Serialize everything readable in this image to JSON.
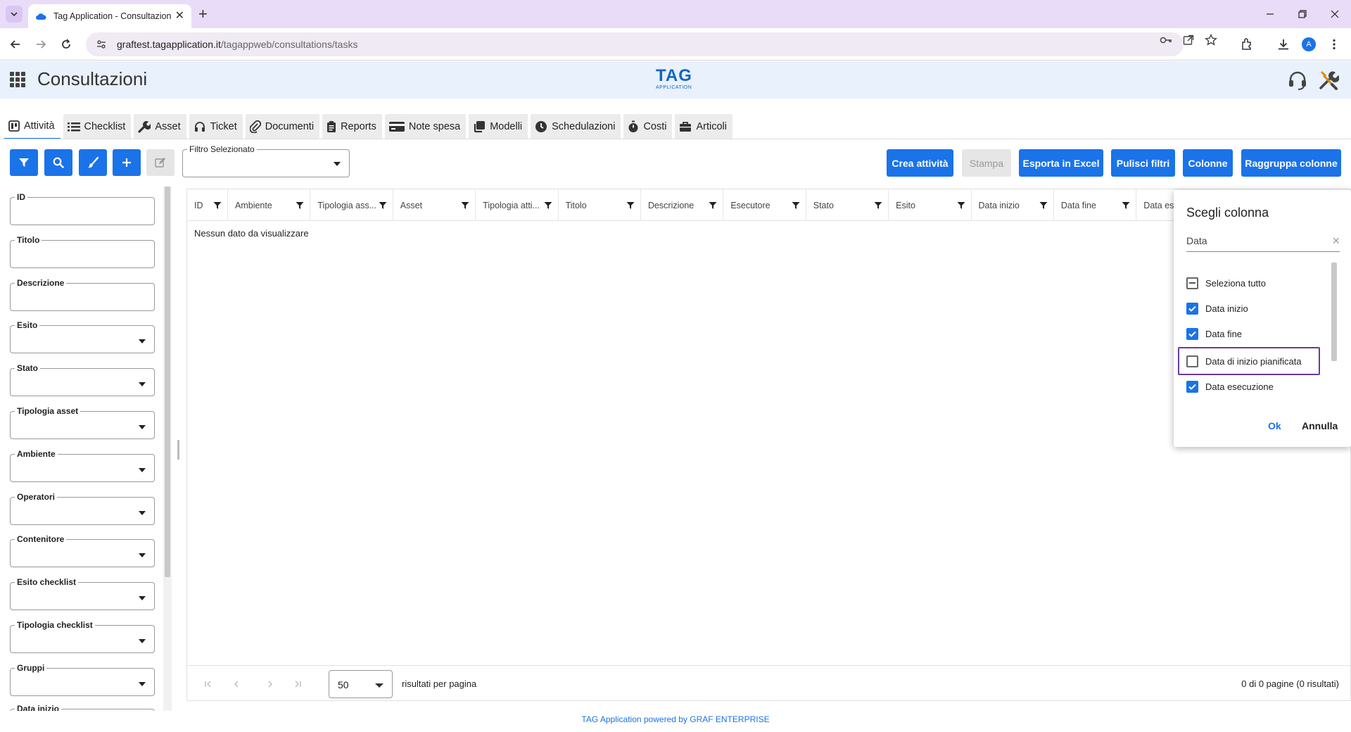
{
  "browser": {
    "tab_title": "Tag Application - Consultazioni",
    "url_host": "graftest.tagapplication.it",
    "url_path": "/tagappweb/consultations/tasks",
    "avatar_letter": "A"
  },
  "app": {
    "title": "Consultazioni",
    "logo_text": "TAG",
    "logo_sub": "APPLICATION",
    "accent": "#1a73e8"
  },
  "tabs": [
    {
      "label": "Attività",
      "icon": "board-icon"
    },
    {
      "label": "Checklist",
      "icon": "list-icon"
    },
    {
      "label": "Asset",
      "icon": "wrench-icon"
    },
    {
      "label": "Ticket",
      "icon": "headset-icon"
    },
    {
      "label": "Documenti",
      "icon": "paperclip-icon"
    },
    {
      "label": "Reports",
      "icon": "clipboard-icon"
    },
    {
      "label": "Note spesa",
      "icon": "credit-card-icon"
    },
    {
      "label": "Modelli",
      "icon": "copy-icon"
    },
    {
      "label": "Schedulazioni",
      "icon": "clock-icon"
    },
    {
      "label": "Costi",
      "icon": "stopwatch-icon"
    },
    {
      "label": "Articoli",
      "icon": "toolbox-icon"
    }
  ],
  "toolbar": {
    "filter_select_label": "Filtro Selezionato",
    "buttons": [
      "Crea attività",
      "Stampa",
      "Esporta in Excel",
      "Pulisci filtri",
      "Colonne",
      "Raggruppa colonne"
    ]
  },
  "filters": [
    {
      "label": "ID",
      "dropdown": false
    },
    {
      "label": "Titolo",
      "dropdown": false
    },
    {
      "label": "Descrizione",
      "dropdown": false
    },
    {
      "label": "Esito",
      "dropdown": true
    },
    {
      "label": "Stato",
      "dropdown": true
    },
    {
      "label": "Tipologia asset",
      "dropdown": true
    },
    {
      "label": "Ambiente",
      "dropdown": true
    },
    {
      "label": "Operatori",
      "dropdown": true
    },
    {
      "label": "Contenitore",
      "dropdown": true
    },
    {
      "label": "Esito checklist",
      "dropdown": true
    },
    {
      "label": "Tipologia checklist",
      "dropdown": true
    },
    {
      "label": "Gruppi",
      "dropdown": true
    },
    {
      "label": "Data inizio",
      "dropdown": false
    }
  ],
  "grid": {
    "columns": [
      "ID",
      "Ambiente",
      "Tipologia ass...",
      "Asset",
      "Tipologia atti...",
      "Titolo",
      "Descrizione",
      "Esecutore",
      "Stato",
      "Esito",
      "Data inizio",
      "Data fine",
      "Data ese"
    ],
    "empty_text": "Nessun dato da visualizzare",
    "page_size": "50",
    "page_size_label": "risultati per pagina",
    "page_info": "0 di 0 pagine (0 risultati)"
  },
  "column_chooser": {
    "title": "Scegli colonna",
    "search_value": "Data",
    "options": [
      {
        "label": "Seleziona tutto",
        "state": "indeterminate"
      },
      {
        "label": "Data inizio",
        "state": "checked"
      },
      {
        "label": "Data fine",
        "state": "checked"
      },
      {
        "label": "Data di inizio pianificata",
        "state": "unchecked"
      },
      {
        "label": "Data esecuzione",
        "state": "checked"
      }
    ],
    "ok_label": "Ok",
    "cancel_label": "Annulla"
  },
  "footer": "TAG Application powered by GRAF ENTERPRISE"
}
